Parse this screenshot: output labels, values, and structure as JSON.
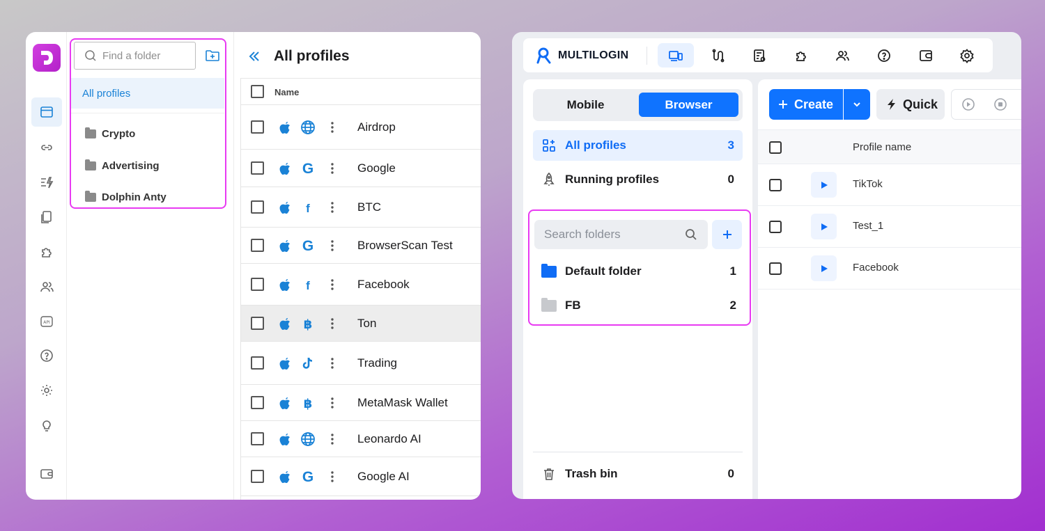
{
  "dolphin": {
    "search": {
      "placeholder": "Find a folder"
    },
    "all_profiles_label": "All profiles",
    "folders": [
      "Crypto",
      "Advertising",
      "Dolphin Anty"
    ],
    "title": "All profiles",
    "table": {
      "column_name": "Name",
      "rows": [
        {
          "name": "Airdrop",
          "site_icon": "globe-icon"
        },
        {
          "name": "Google",
          "site_icon": "google-icon"
        },
        {
          "name": "BTC",
          "site_icon": "facebook-icon"
        },
        {
          "name": "BrowserScan Test",
          "site_icon": "google-icon"
        },
        {
          "name": "Facebook",
          "site_icon": "facebook-icon"
        },
        {
          "name": "Ton",
          "site_icon": "bitcoin-icon",
          "selected": true
        },
        {
          "name": "Trading",
          "site_icon": "tiktok-icon"
        },
        {
          "name": "MetaMask Wallet",
          "site_icon": "bitcoin-icon"
        },
        {
          "name": "Leonardo AI",
          "site_icon": "globe-icon"
        },
        {
          "name": "Google AI",
          "site_icon": "google-icon"
        }
      ]
    },
    "colors": {
      "accent": "#1a82d6",
      "logo": "#c42fd8",
      "highlight": "#e83af2"
    }
  },
  "multilogin": {
    "logo_text": "MULTILOGIN",
    "segment": {
      "mobile": "Mobile",
      "browser": "Browser"
    },
    "nav": {
      "all_profiles": {
        "label": "All profiles",
        "count": "3"
      },
      "running_profiles": {
        "label": "Running profiles",
        "count": "0"
      }
    },
    "search": {
      "placeholder": "Search folders"
    },
    "folders": [
      {
        "name": "Default folder",
        "count": "1"
      },
      {
        "name": "FB",
        "count": "2"
      }
    ],
    "trash": {
      "label": "Trash bin",
      "count": "0"
    },
    "toolbar": {
      "create_label": "Create",
      "quick_label": "Quick"
    },
    "table": {
      "column_name": "Profile name",
      "rows": [
        "TikTok",
        "Test_1",
        "Facebook"
      ]
    },
    "colors": {
      "primary": "#0f73ff",
      "active_bg": "#e8f1ff",
      "highlight": "#e83af2"
    }
  }
}
